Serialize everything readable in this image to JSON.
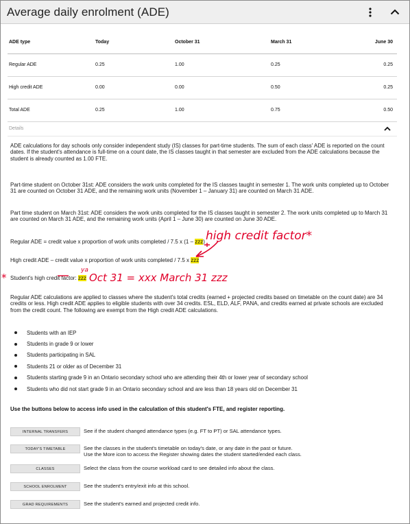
{
  "header": {
    "title": "Average daily enrolment (ADE)"
  },
  "table": {
    "headers": [
      "ADE type",
      "Today",
      "October 31",
      "March 31",
      "June 30"
    ],
    "rows": [
      [
        "Regular ADE",
        "0.25",
        "1.00",
        "0.25",
        "0.25"
      ],
      [
        "High credit ADE",
        "0.00",
        "0.00",
        "0.50",
        "0.25"
      ],
      [
        "Total ADE",
        "0.25",
        "1.00",
        "0.75",
        "0.50"
      ]
    ]
  },
  "details": {
    "label": "Details",
    "p1": "ADE calculations for day schools only consider independent study (IS) classes for part-time students. The sum of each class' ADE is reported on the count dates. If the student's attendance is full-time on a count date, the IS classes taught in that semester are excluded from the ADE calculations because the student is already counted as 1.00 FTE.",
    "p2": "Part-time student on October 31st: ADE considers the work units completed for the IS classes taught in semester 1. The work units completed up to October 31 are counted on October 31 ADE, and the remaining work units (November 1 – January 31) are counted on March 31 ADE.",
    "p3": "Part time student on March 31st: ADE considers the work units completed for the IS classes taught in semester 2. The work units completed up to March 31 are counted on March 31 ADE, and the remaining work units (April 1 – June 30) are counted on June 30 ADE.",
    "p4_prefix": "Regular ADE = credit value x proportion of work units completed / 7.5 x (1 – ",
    "p4_hl": "zzz",
    "p4_suffix": ")",
    "p5_prefix": "High credit ADE – credit value x proportion of work units completed / 7.5 x ",
    "p5_hl": "zzz",
    "p6_prefix": "Student's high credit factor: ",
    "p6_hl": "zzz",
    "p7": "Regular ADE calculations are applied to classes where the student's total credits (earned + projected credits based on timetable on the count date) are 34 credits or less. High credit ADE applies to eligible students with over 34 credits. ESL, ELD, ALF, PANA, and credits earned at private schools are excluded from the credit count. The following are exempt from the High credit ADE calculations.",
    "bullets": [
      "Students with an IEP",
      "Students in grade 9 or lower",
      "Students participating in SAL",
      "Students 21 or older as of December 31",
      "Students starting grade 9 in an Ontario secondary school who are attending their 4th or lower year of secondary school",
      "Students who did not start grade 9 in an Ontario secondary school and are less than 18 years old on December 31"
    ]
  },
  "links": {
    "heading": "Use the buttons below to access info used in the calculation of this student's FTE, and register reporting.",
    "items": [
      {
        "label": "INTERNAL TRANSFERS",
        "desc": "See if the student changed attendance types (e.g. FT to PT) or SAL attendance types."
      },
      {
        "label": "TODAY'S TIMETABLE",
        "desc": "See the classes in the student's timetable on today's date, or any date in the past or future.",
        "desc2": "Use the More icon to access the Register showing dates the student started/ended each class."
      },
      {
        "label": "CLASSES",
        "desc": "Select the class from the course workload card to see detailed info about the class."
      },
      {
        "label": "SCHOOL ENROLMENT",
        "desc": "See the student's entry/exit info at this school."
      },
      {
        "label": "GRAD REQUIREMENTS",
        "desc": "See the student's earned and projected credit info."
      }
    ]
  },
  "annotations": {
    "note1": "high credit factor*",
    "note2": "Oct 31 = xxx   March 31 zzz",
    "note3": "ya",
    "star": "*",
    "color": "#e0002a"
  },
  "colors": {
    "header_bg": "#efefef",
    "highlight": "#f2e600",
    "button_bg": "#e4e4e4"
  }
}
